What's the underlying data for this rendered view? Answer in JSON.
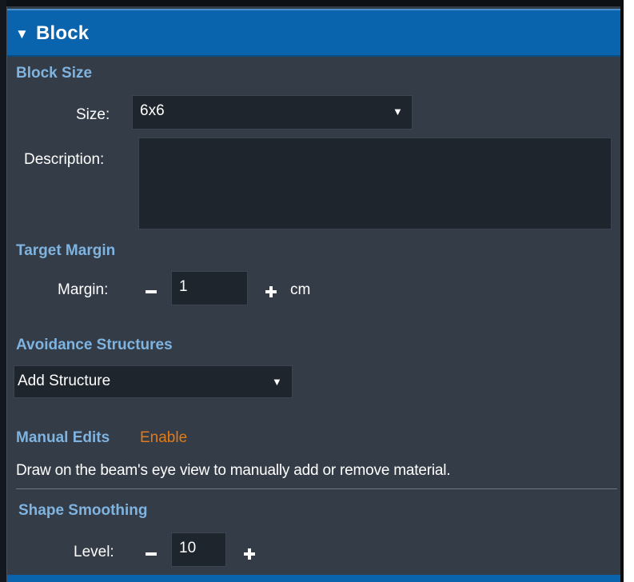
{
  "header": {
    "caret_icon": "▼",
    "title": "Block"
  },
  "block_size": {
    "section_title": "Block Size",
    "size_label": "Size:",
    "size_value": "6x6",
    "dropdown_icon": "▼",
    "description_label": "Description:",
    "description_value": ""
  },
  "target_margin": {
    "section_title": "Target Margin",
    "margin_label": "Margin:",
    "margin_value": "1",
    "unit": "cm"
  },
  "avoidance": {
    "section_title": "Avoidance Structures",
    "add_structure_label": "Add Structure",
    "dropdown_icon": "▼"
  },
  "manual_edits": {
    "section_title": "Manual Edits",
    "enable_label": "Enable",
    "help_text": "Draw on the beam's eye view to manually add or remove material."
  },
  "shape_smoothing": {
    "section_title": "Shape Smoothing",
    "level_label": "Level:",
    "level_value": "10"
  },
  "colors": {
    "header_bg": "#0a64ad",
    "panel_bg": "#343c47",
    "section_title": "#7fb3e0",
    "link": "#e17b1a",
    "input_bg": "#1f252d"
  }
}
